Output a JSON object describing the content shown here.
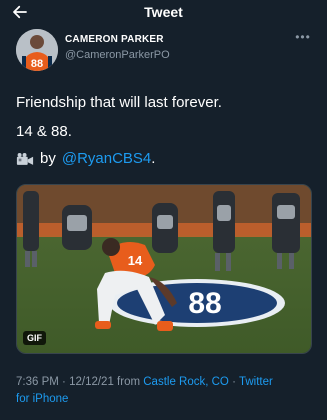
{
  "header": {
    "title": "Tweet",
    "back_icon": "arrow-left-icon"
  },
  "author": {
    "display_name": "CAMERON PARKER",
    "handle": "@CameronParkerPO",
    "avatar_icon": "user-avatar",
    "jersey_number": "88"
  },
  "tweet": {
    "line1": "Friendship that will last forever.",
    "line2": "14 & 88.",
    "by_label": "by",
    "mention": "@RyanCBS4",
    "trailing": ".",
    "camera_icon": "video-camera-icon"
  },
  "media": {
    "badge": "GIF",
    "field_number": "88",
    "player_number": "14"
  },
  "meta": {
    "time": "7:36 PM",
    "separator": "·",
    "date": "12/12/21",
    "from_label": "from",
    "location": "Castle Rock, CO",
    "client_line1": "Twitter",
    "client_line2": "for iPhone"
  },
  "colors": {
    "background": "#15202b",
    "link": "#1d9bf0",
    "secondary_text": "#8b98a5",
    "broncos_orange": "#e85d1c",
    "broncos_navy": "#0b2a4a"
  }
}
